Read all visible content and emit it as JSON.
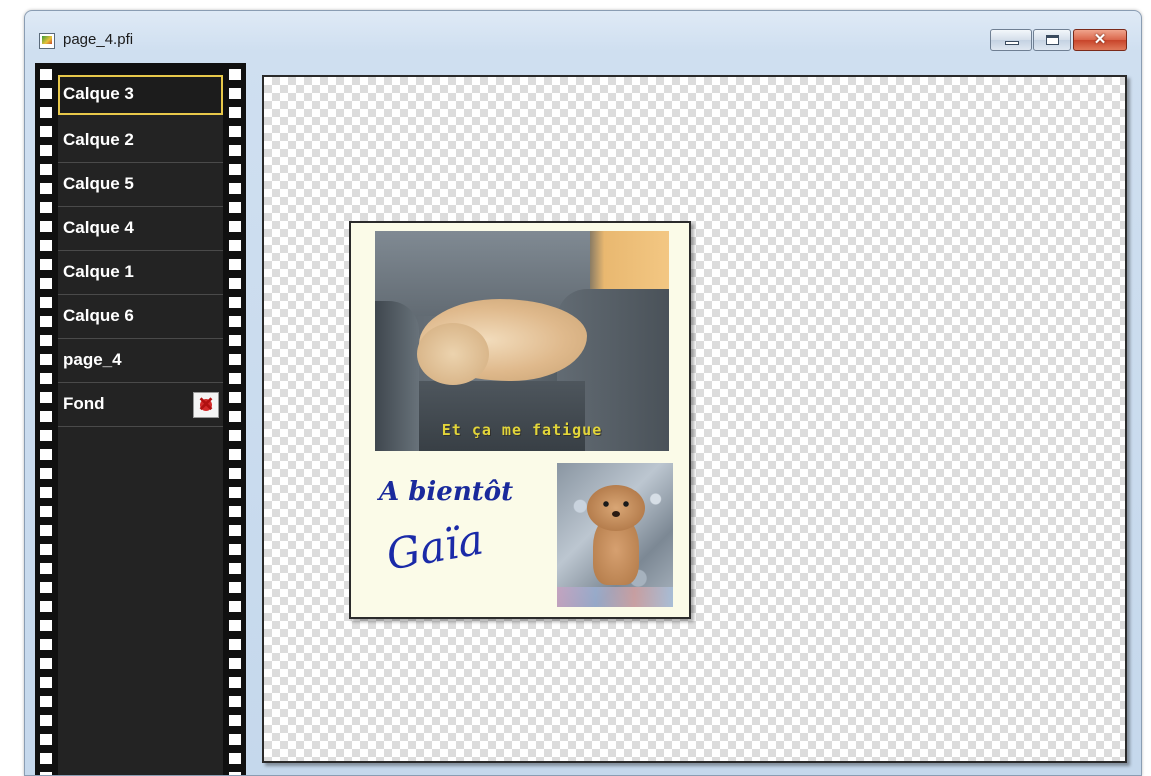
{
  "window": {
    "title": "page_4.pfi",
    "icon": "image-file-icon",
    "controls": {
      "minimize": "minimize-icon",
      "maximize": "maximize-icon",
      "close_glyph": "✕"
    }
  },
  "layers": {
    "items": [
      {
        "label": "Calque 3",
        "selected": true
      },
      {
        "label": "Calque 2"
      },
      {
        "label": "Calque 5"
      },
      {
        "label": "Calque 4"
      },
      {
        "label": "Calque 1"
      },
      {
        "label": "Calque 6"
      },
      {
        "label": "page_4"
      },
      {
        "label": "Fond",
        "icon": "locked-icon"
      }
    ],
    "selection_color": "#e8c84a"
  },
  "canvas": {
    "card": {
      "photo_caption": "Et ça me fatigue",
      "greeting_line1": "A bientôt",
      "greeting_line2": "Gaïa",
      "text_color": "#1a2a9c",
      "caption_color": "#e2d53a"
    }
  }
}
